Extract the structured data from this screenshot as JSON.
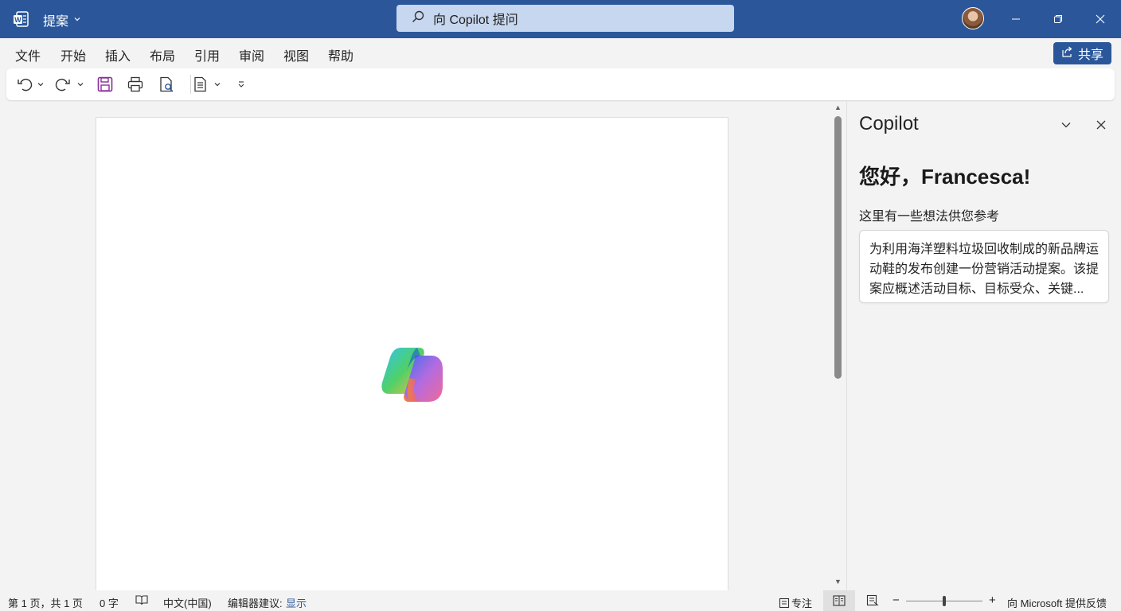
{
  "titlebar": {
    "doc_title": "提案",
    "search_text": "向 Copilot 提问",
    "accent_color": "#2b579a"
  },
  "menu": {
    "items": [
      "文件",
      "开始",
      "插入",
      "布局",
      "引用",
      "审阅",
      "视图",
      "帮助"
    ],
    "share_label": "共享"
  },
  "toolbar": {
    "icons": [
      "undo-icon",
      "redo-icon",
      "save-icon",
      "print-icon",
      "print-preview-icon",
      "document-view-icon",
      "customize-toolbar-icon"
    ]
  },
  "copilot": {
    "pane_title": "Copilot",
    "greeting": "您好，Francesca!",
    "ideas_label": "这里有一些想法供您参考",
    "prompt_text": "为利用海洋塑料垃圾回收制成的新品牌运动鞋的发布创建一份营销活动提案。该提案应概述活动目标、目标受众、关键..."
  },
  "status": {
    "page": "第 1 页，共 1 页",
    "words": "0 字",
    "language": "中文(中国)",
    "editor_label": "编辑器建议:",
    "editor_value": "显示",
    "focus": "专注",
    "feedback": "向 Microsoft 提供反馈",
    "zoom_minus": "−",
    "zoom_plus": "+"
  }
}
